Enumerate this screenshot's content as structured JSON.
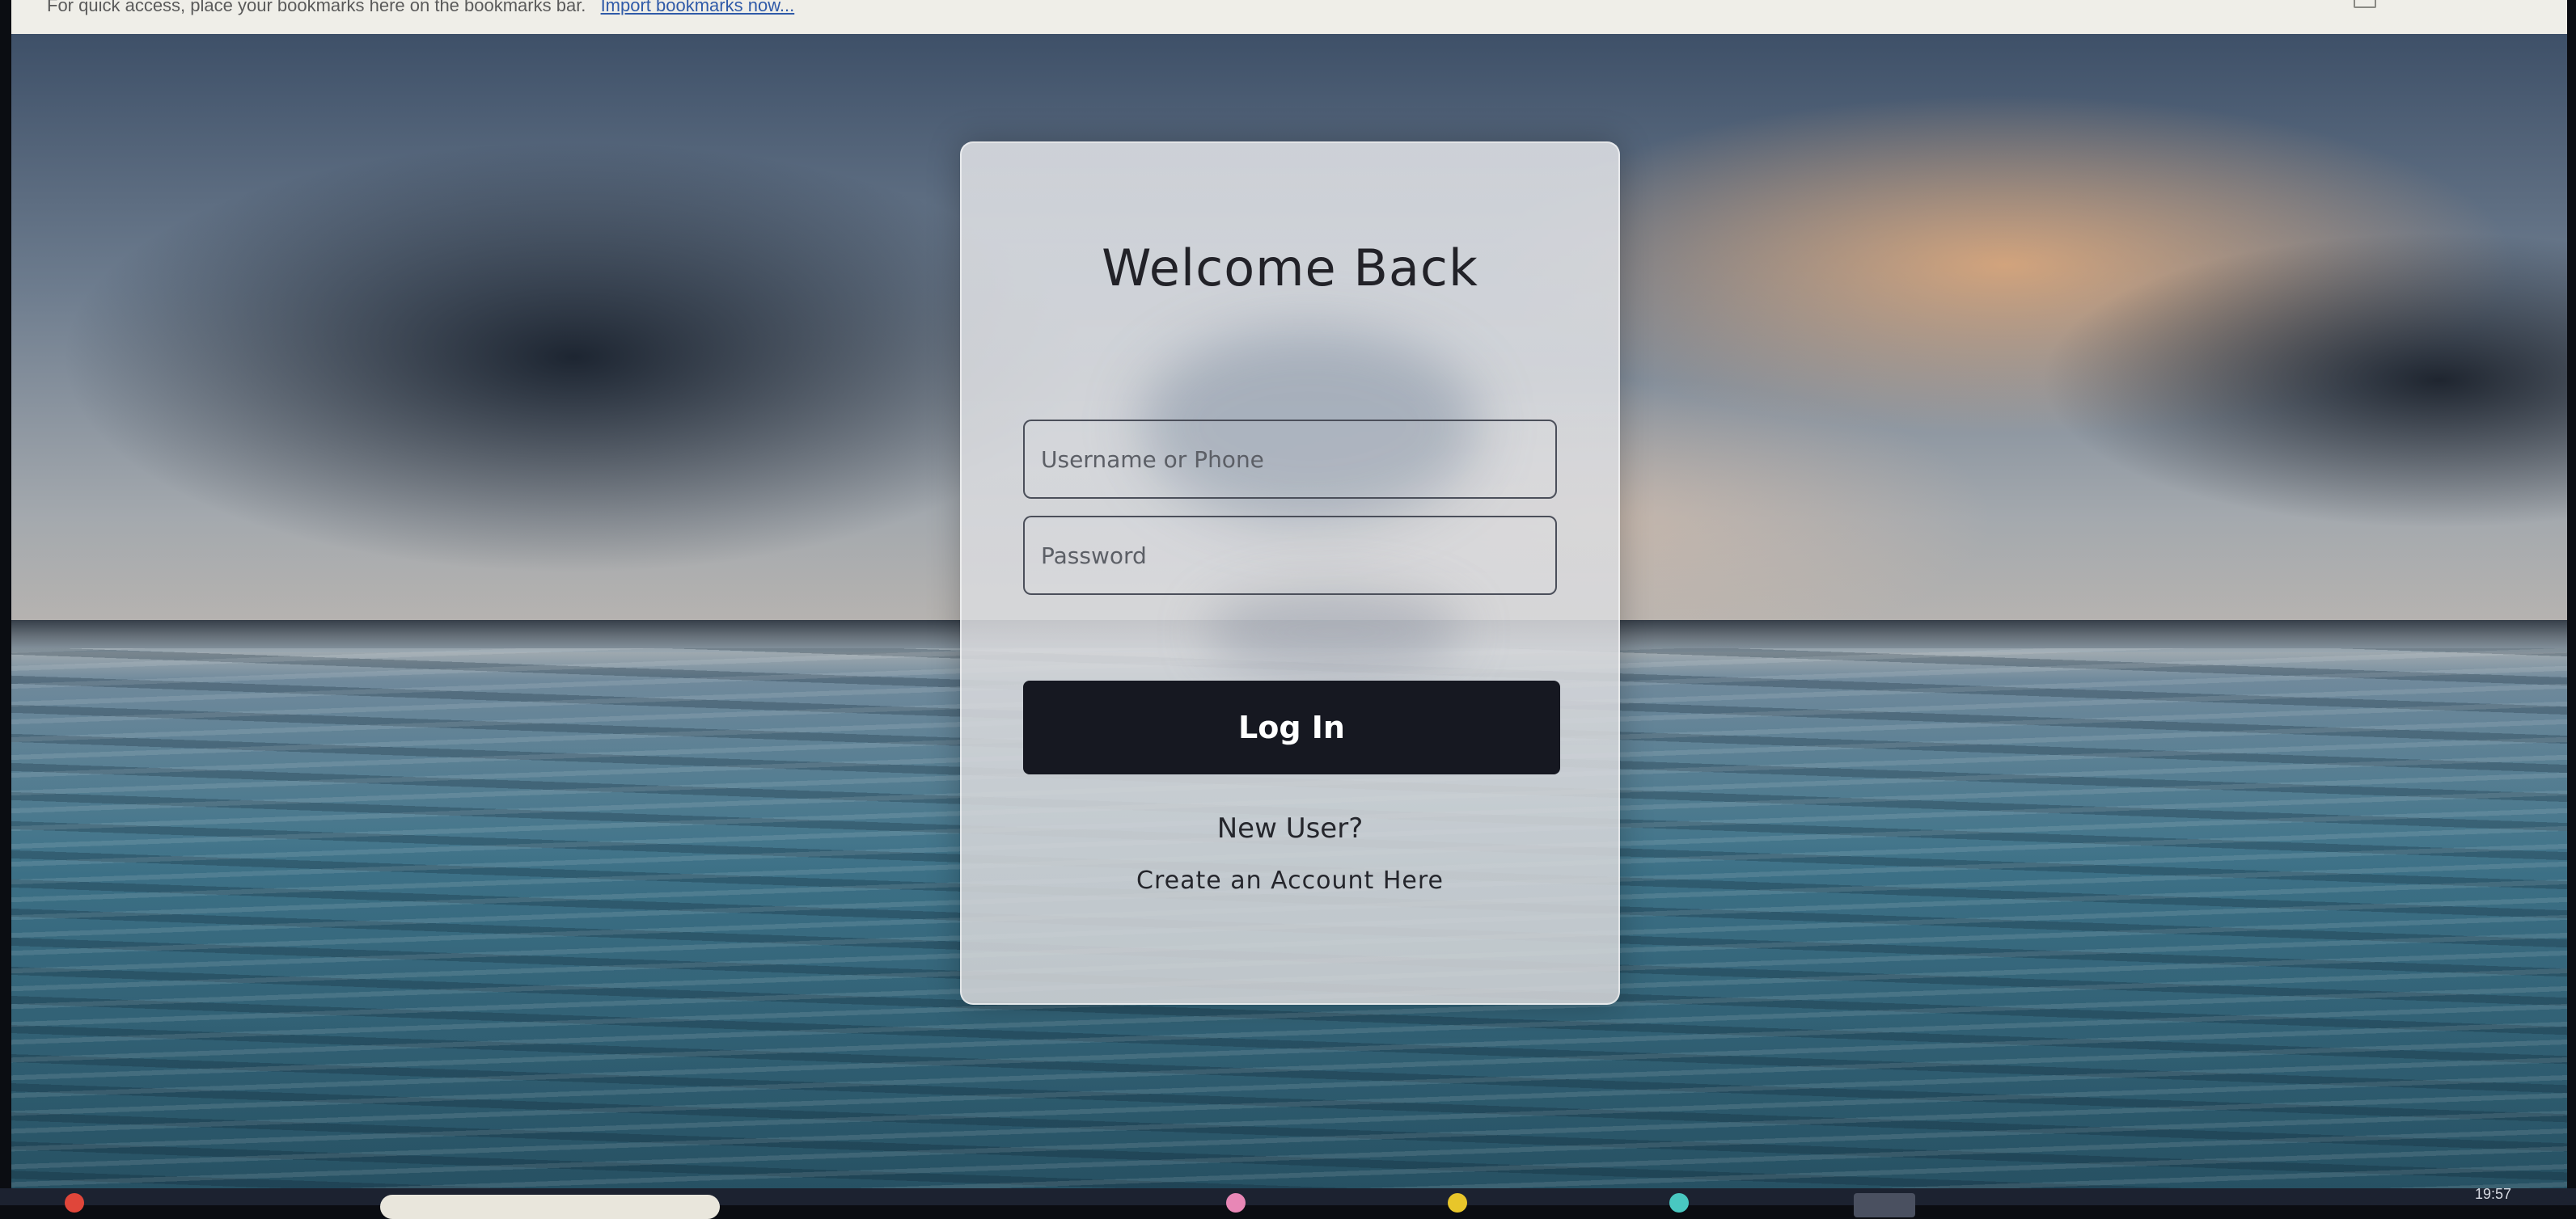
{
  "bookmarks_bar": {
    "text": "For quick access, place your bookmarks here on the bookmarks bar.",
    "link": "Import bookmarks now..."
  },
  "login": {
    "title": "Welcome Back",
    "username_placeholder": "Username or Phone",
    "password_placeholder": "Password",
    "login_button": "Log In",
    "new_user": "New User?",
    "create_account": "Create an Account Here"
  },
  "taskbar": {
    "clock": "19:57"
  },
  "colors": {
    "button": "#161821",
    "card": "#dedfe3",
    "bookmarks_bar": "#efeee8",
    "link": "#2f5aa8"
  }
}
